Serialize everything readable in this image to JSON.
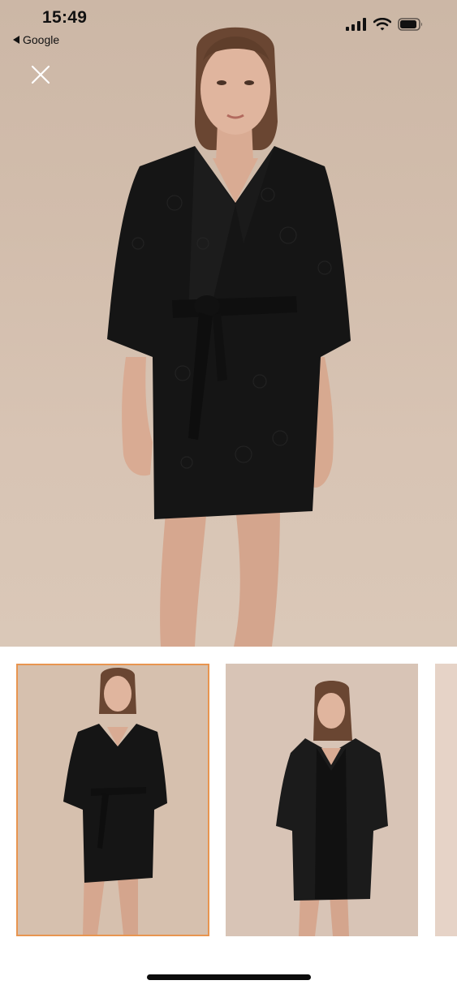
{
  "status_bar": {
    "time": "15:49",
    "back_label": "Google",
    "icons": [
      "cellular-signal-icon",
      "wifi-icon",
      "battery-icon"
    ]
  },
  "viewer": {
    "close_icon": "close-icon",
    "main_image": "product-photo-black-jacquard-kimono-robe-front",
    "thumbnails": [
      {
        "image": "robe-front-view",
        "selected": true
      },
      {
        "image": "robe-over-slip-dress-view",
        "selected": false
      },
      {
        "image": "partial-next-thumbnail",
        "selected": false
      }
    ],
    "selected_border_color": "#e89550"
  },
  "colors": {
    "background_beige": "#d2bdac",
    "garment_black": "#151515"
  }
}
